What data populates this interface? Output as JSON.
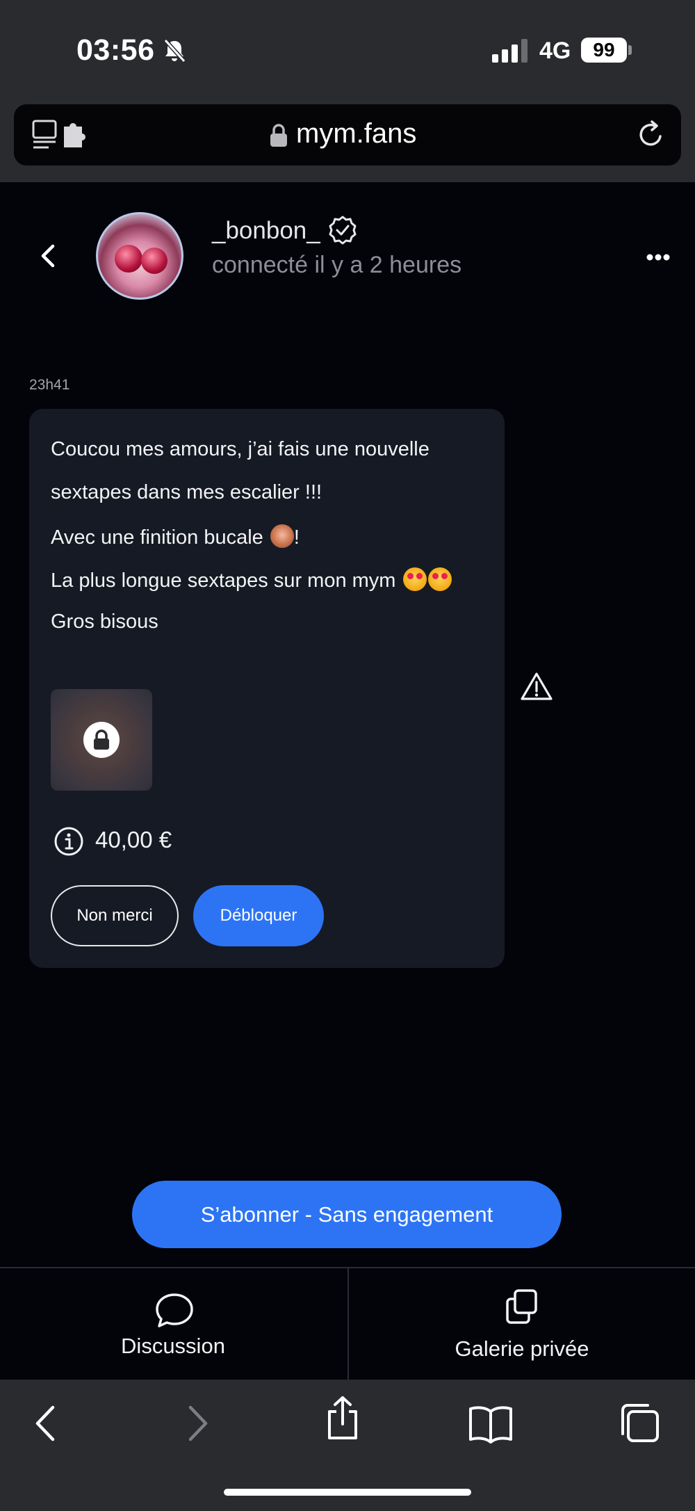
{
  "status_bar": {
    "time": "03:56",
    "network": "4G",
    "battery": "99"
  },
  "browser": {
    "url": "mym.fans"
  },
  "chat_header": {
    "username": "_bonbon_",
    "status": "connecté il y a 2 heures"
  },
  "message": {
    "time": "23h41",
    "lines": [
      "Coucou mes amours, j’ai fais une nouvelle",
      "sextapes dans mes escalier !!!",
      "Avec une finition bucale",
      "La plus longue sextapes sur mon mym",
      "Gros bisous"
    ],
    "line3_suffix": "!",
    "price": "40,00 €",
    "decline_label": "Non merci",
    "unlock_label": "Débloquer"
  },
  "subscribe": {
    "label": "S’abonner - Sans engagement"
  },
  "tabs": [
    {
      "label": "Discussion"
    },
    {
      "label": "Galerie privée"
    }
  ],
  "colors": {
    "accent": "#2d74f5",
    "background": "#03040a",
    "bubble": "#161a24",
    "chrome": "#2a2b2f"
  },
  "icons": [
    "bell-slash-icon",
    "signal-icon",
    "lock-icon",
    "reload-icon",
    "tabs-icon",
    "extension-icon",
    "chevron-left-icon",
    "verified-icon",
    "more-icon",
    "info-icon",
    "warning-icon",
    "chat-bubble-icon",
    "gallery-icon",
    "share-icon",
    "book-icon",
    "tabs-overview-icon"
  ]
}
